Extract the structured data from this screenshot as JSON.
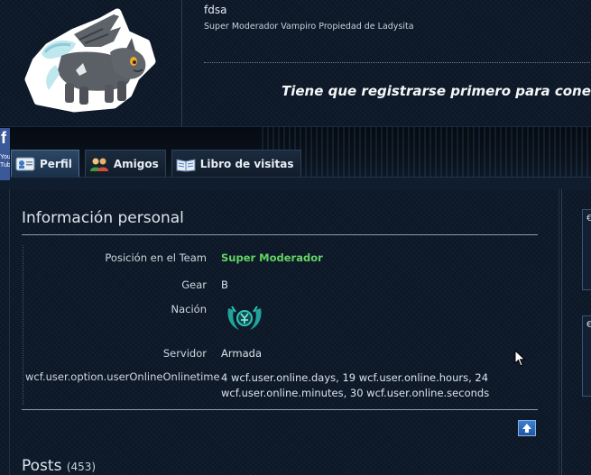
{
  "header": {
    "username": "fdsa",
    "user_title": "Super Moderador Vampiro Propiedad de Ladysita",
    "register_message": "Tiene que registrarse primero para conectarse"
  },
  "social": {
    "facebook_letter": "f",
    "youtube_label": "You Tube"
  },
  "tabs": [
    {
      "label": "Perfil",
      "icon": "profile-card-icon",
      "active": true
    },
    {
      "label": "Amigos",
      "icon": "friends-icon",
      "active": false
    },
    {
      "label": "Libro de visitas",
      "icon": "guestbook-icon",
      "active": false
    }
  ],
  "personal_info": {
    "title": "Información personal",
    "fields": [
      {
        "label": "Posición en el Team",
        "value": "Super Moderador"
      },
      {
        "label": "Gear",
        "value": "B"
      },
      {
        "label": "Nación",
        "value": ""
      },
      {
        "label": "Servidor",
        "value": "Armada"
      }
    ],
    "online_time": {
      "label": "wcf.user.option.userOnlineOnlinetime",
      "value": "4 wcf.user.online.days, 19 wcf.user.online.hours, 24 wcf.user.online.minutes, 30 wcf.user.online.seconds"
    }
  },
  "posts": {
    "title": "Posts",
    "count": "(453)"
  },
  "colors": {
    "background": "#0e1a2a",
    "highlight_green": "#63d463",
    "facebook_blue": "#3b5998",
    "top_button_blue": "#2b6cc0"
  }
}
